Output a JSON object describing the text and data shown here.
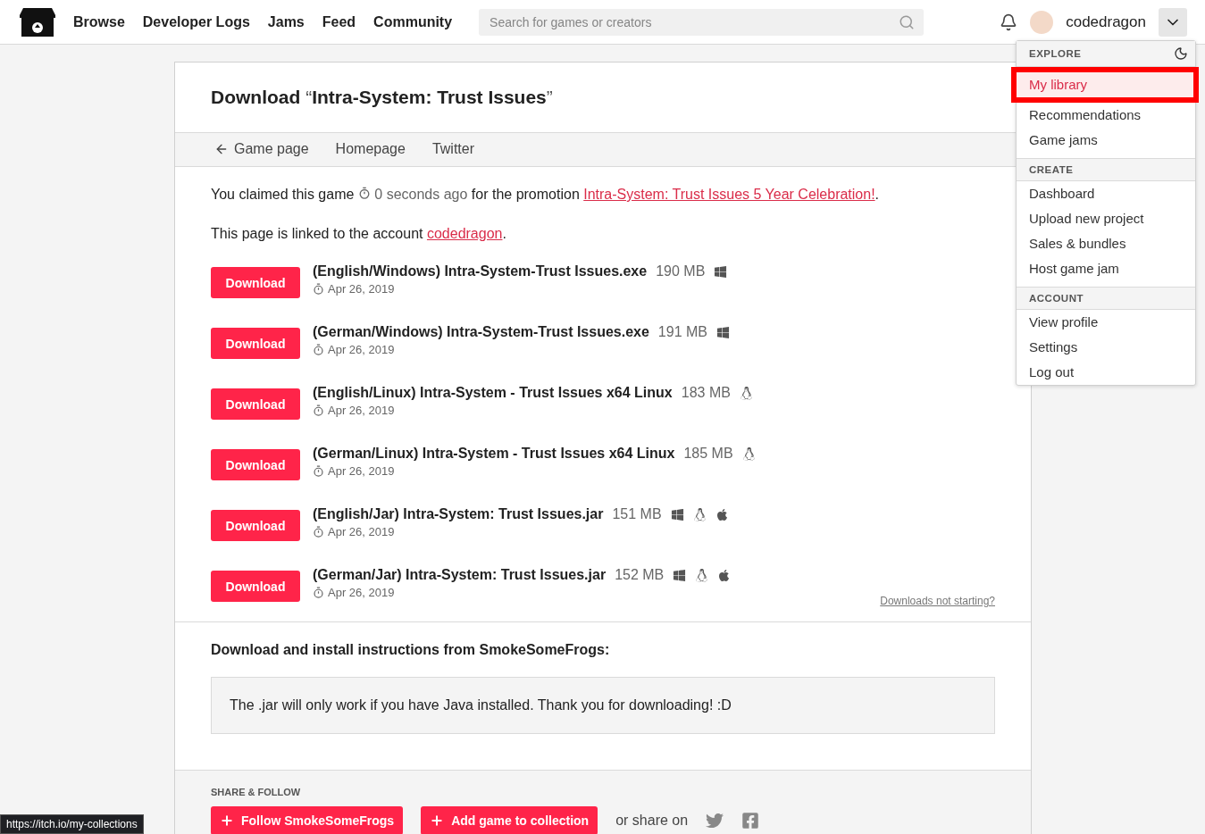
{
  "header": {
    "nav": [
      "Browse",
      "Developer Logs",
      "Jams",
      "Feed",
      "Community"
    ],
    "search": {
      "placeholder": "Search for games or creators"
    },
    "username": "codedragon"
  },
  "menu": {
    "sections": [
      {
        "title": "EXPLORE",
        "items": [
          {
            "label": "My library",
            "highlighted": true
          },
          {
            "label": "Recommendations",
            "highlighted": false
          },
          {
            "label": "Game jams",
            "highlighted": false
          }
        ]
      },
      {
        "title": "CREATE",
        "items": [
          {
            "label": "Dashboard",
            "highlighted": false
          },
          {
            "label": "Upload new project",
            "highlighted": false
          },
          {
            "label": "Sales & bundles",
            "highlighted": false
          },
          {
            "label": "Host game jam",
            "highlighted": false
          }
        ]
      },
      {
        "title": "ACCOUNT",
        "items": [
          {
            "label": "View profile",
            "highlighted": false
          },
          {
            "label": "Settings",
            "highlighted": false
          },
          {
            "label": "Log out",
            "highlighted": false
          }
        ]
      }
    ]
  },
  "page": {
    "title_prefix": "Download ",
    "title_quote_open": "“",
    "title_game": "Intra-System: Trust Issues",
    "title_quote_close": "”",
    "tabs": [
      "Game page",
      "Homepage",
      "Twitter"
    ],
    "claim": {
      "before": "You claimed this game",
      "time": "0 seconds ago",
      "middle": "for the promotion",
      "link": "Intra-System: Trust Issues 5 Year Celebration!",
      "after": "."
    },
    "account": {
      "before": "This page is linked to the account",
      "link": "codedragon",
      "after": "."
    },
    "downloads": [
      {
        "button": "Download",
        "name": "(English/Windows) Intra-System-Trust Issues.exe",
        "size": "190 MB",
        "date": "Apr 26, 2019",
        "platforms": [
          {
            "kind": "windows"
          }
        ]
      },
      {
        "button": "Download",
        "name": "(German/Windows) Intra-System-Trust Issues.exe",
        "size": "191 MB",
        "date": "Apr 26, 2019",
        "platforms": [
          {
            "kind": "windows"
          }
        ]
      },
      {
        "button": "Download",
        "name": "(English/Linux) Intra-System - Trust Issues x64 Linux",
        "size": "183 MB",
        "date": "Apr 26, 2019",
        "platforms": [
          {
            "kind": "linux"
          }
        ]
      },
      {
        "button": "Download",
        "name": "(German/Linux) Intra-System - Trust Issues x64 Linux",
        "size": "185 MB",
        "date": "Apr 26, 2019",
        "platforms": [
          {
            "kind": "linux"
          }
        ]
      },
      {
        "button": "Download",
        "name": "(English/Jar) Intra-System: Trust Issues.jar",
        "size": "151 MB",
        "date": "Apr 26, 2019",
        "platforms": [
          {
            "kind": "windows"
          },
          {
            "kind": "linux"
          },
          {
            "kind": "mac"
          }
        ]
      },
      {
        "button": "Download",
        "name": "(German/Jar) Intra-System: Trust Issues.jar",
        "size": "152 MB",
        "date": "Apr 26, 2019",
        "platforms": [
          {
            "kind": "windows"
          },
          {
            "kind": "linux"
          },
          {
            "kind": "mac"
          }
        ]
      }
    ],
    "not_starting": "Downloads not starting?",
    "instructions_title": "Download and install instructions from SmokeSomeFrogs:",
    "instructions": "The .jar will only work if you have Java installed. Thank you for downloading! :D",
    "share": {
      "title": "SHARE & FOLLOW",
      "follow": "Follow SmokeSomeFrogs",
      "collection": "Add game to collection",
      "share_on": "or share on"
    }
  },
  "status_url": "https://itch.io/my-collections"
}
